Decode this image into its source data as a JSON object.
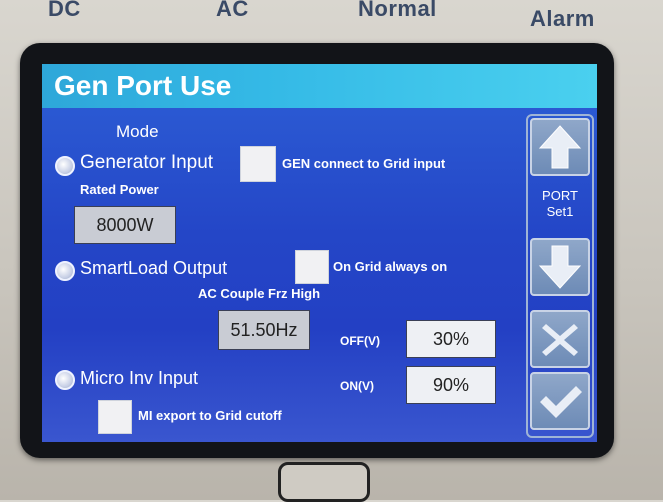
{
  "device_labels": {
    "dc": "DC",
    "ac": "AC",
    "normal": "Normal",
    "alarm": "Alarm"
  },
  "screen": {
    "title": "Gen Port Use",
    "mode_label": "Mode",
    "generator": {
      "label": "Generator Input",
      "checkbox_label": "GEN connect to Grid input",
      "rated_power_label": "Rated Power",
      "rated_power_value": "8000W"
    },
    "smartload": {
      "label": "SmartLoad Output",
      "checkbox_label": "On Grid always on",
      "ac_couple_label": "AC Couple Frz High",
      "ac_couple_value": "51.50Hz",
      "off_label": "OFF(V)",
      "off_value": "30%",
      "on_label": "ON(V)",
      "on_value": "90%"
    },
    "microinv": {
      "label": "Micro Inv Input",
      "checkbox_label": "MI export to Grid cutoff"
    },
    "sidebar": {
      "port_line1": "PORT",
      "port_line2": "Set1"
    }
  }
}
